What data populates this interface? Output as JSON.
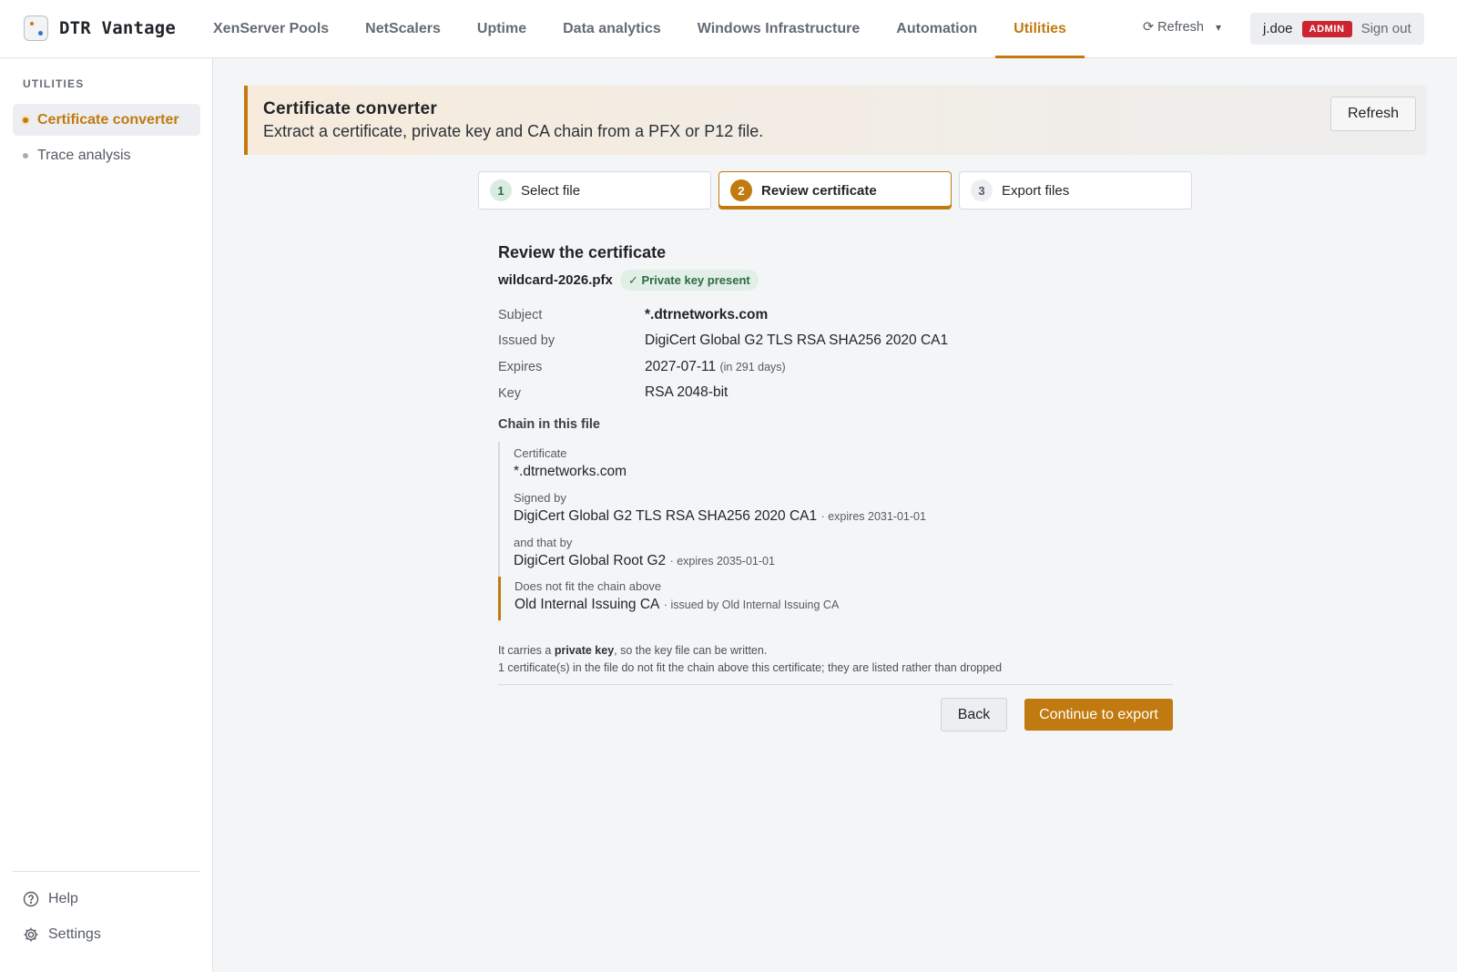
{
  "app": {
    "name": "DTR Vantage"
  },
  "nav": {
    "items": [
      {
        "label": "XenServer Pools"
      },
      {
        "label": "NetScalers"
      },
      {
        "label": "Uptime"
      },
      {
        "label": "Data analytics"
      },
      {
        "label": "Windows Infrastructure"
      },
      {
        "label": "Automation"
      },
      {
        "label": "Utilities",
        "active": true
      }
    ],
    "refresh_label": "⟳ Refresh",
    "caret": "▾"
  },
  "user": {
    "name": "j.doe",
    "role_badge": "ADMIN",
    "signout_label": "Sign out"
  },
  "sidebar": {
    "heading": "UTILITIES",
    "items": [
      {
        "label": "Certificate converter",
        "active": true
      },
      {
        "label": "Trace analysis"
      }
    ],
    "help_label": "Help",
    "settings_label": "Settings"
  },
  "banner": {
    "title": "Certificate converter",
    "subtitle": "Extract a certificate, private key and CA chain from a PFX or P12 file.",
    "refresh_label": "Refresh"
  },
  "steps": [
    {
      "num": "1",
      "label": "Select file",
      "state": "done"
    },
    {
      "num": "2",
      "label": "Review certificate",
      "state": "active"
    },
    {
      "num": "3",
      "label": "Export files",
      "state": "todo"
    }
  ],
  "review": {
    "title": "Review the certificate",
    "filename": "wildcard-2026.pfx",
    "key_badge": "✓ Private key present",
    "fields": {
      "subject_label": "Subject",
      "subject_value": "*.dtrnetworks.com",
      "issuer_label": "Issued by",
      "issuer_value": "DigiCert Global G2 TLS RSA SHA256 2020 CA1",
      "expires_label": "Expires",
      "expires_value": "2027-07-11",
      "expires_note": "(in 291 days)",
      "key_label": "Key",
      "key_value": "RSA 2048-bit"
    },
    "chain_title": "Chain in this file",
    "chain": [
      {
        "label": "Certificate",
        "name": "*.dtrnetworks.com",
        "meta": ""
      },
      {
        "label": "Signed by",
        "name": "DigiCert Global G2 TLS RSA SHA256 2020 CA1",
        "meta": "· expires 2031-01-01"
      },
      {
        "label": "and that by",
        "name": "DigiCert Global Root G2",
        "meta": "· expires 2035-01-01"
      },
      {
        "label": "Does not fit the chain above",
        "name": "Old Internal Issuing CA",
        "meta": "· issued by Old Internal Issuing CA"
      }
    ],
    "note1_prefix": "It carries a ",
    "note1_bold": "private key",
    "note1_suffix": ", so the key file can be written.",
    "note2": "1 certificate(s) in the file do not fit the chain above this certificate; they are listed rather than dropped",
    "back_label": "Back",
    "continue_label": "Continue to export"
  },
  "colors": {
    "accent": "#c17a10",
    "badge_red": "#cc2431",
    "success_green": "#2d6b43"
  }
}
